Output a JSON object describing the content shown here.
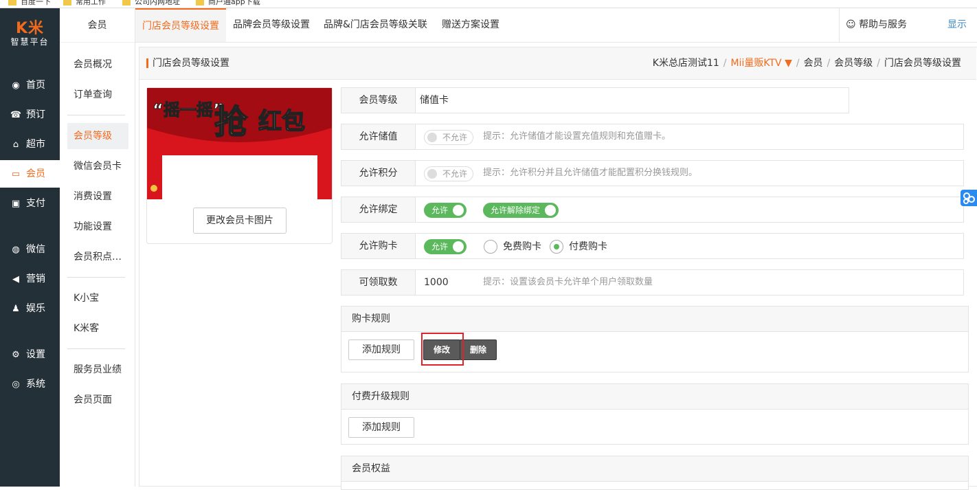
{
  "bookmarks": [
    "百度一下",
    "常用工作",
    "公司内网地址",
    "商户通app下载"
  ],
  "logo": {
    "brand": "K米",
    "subtitle": "智慧平台"
  },
  "leftnav": [
    {
      "label": "首页",
      "icon": "gauge-icon",
      "glyph": "◉"
    },
    {
      "label": "预订",
      "icon": "phone-icon",
      "glyph": "☎"
    },
    {
      "label": "超市",
      "icon": "basket-icon",
      "glyph": "⌂"
    },
    {
      "label": "会员",
      "icon": "card-icon",
      "glyph": "▭",
      "active": true
    },
    {
      "label": "支付",
      "icon": "money-icon",
      "glyph": "▣"
    },
    {
      "label": "微信",
      "icon": "wechat-icon",
      "glyph": "◍"
    },
    {
      "label": "营销",
      "icon": "megaphone-icon",
      "glyph": "◀"
    },
    {
      "label": "娱乐",
      "icon": "game-icon",
      "glyph": "♟"
    },
    {
      "label": "设置",
      "icon": "gears-icon",
      "glyph": "⚙"
    },
    {
      "label": "系统",
      "icon": "chrome-icon",
      "glyph": "◎"
    }
  ],
  "subnav": {
    "header": "会员",
    "items": [
      "会员概况",
      "订单查询",
      "会员等级",
      "微信会员卡",
      "消费设置",
      "功能设置",
      "会员积点…",
      "K小宝",
      "K米客",
      "服务员业绩",
      "会员页面"
    ],
    "active": "会员等级"
  },
  "tabs": [
    "门店会员等级设置",
    "品牌会员等级设置",
    "品牌&门店会员等级关联",
    "赠送方案设置"
  ],
  "help": {
    "icon": "smiley-icon",
    "label": "帮助与服务"
  },
  "show_label": "显示",
  "page": {
    "title": "门店会员等级设置",
    "breadcrumb": {
      "company": "K米总店测试11",
      "store": "Mii量贩KTV",
      "items": [
        "会员",
        "会员等级",
        "门店会员等级设置"
      ]
    }
  },
  "card": {
    "image_quote": "“摇一摇”",
    "image_big": "抢",
    "image_rest": "红包",
    "change_button": "更改会员卡图片"
  },
  "form": {
    "level": {
      "label": "会员等级",
      "value": "储值卡"
    },
    "allow_stored": {
      "label": "允许储值",
      "toggle": "不允许",
      "hint": "提示：允许储值才能设置充值规则和充值赠卡。"
    },
    "allow_points": {
      "label": "允许积分",
      "toggle": "不允许",
      "hint": "提示：允许积分并且允许储值才能配置积分换钱规则。"
    },
    "allow_bind": {
      "label": "允许绑定",
      "toggle1": "允许",
      "toggle2": "允许解除绑定"
    },
    "allow_buy": {
      "label": "允许购卡",
      "toggle": "允许",
      "radio_free": "免费购卡",
      "radio_paid": "付费购卡"
    },
    "max_claim": {
      "label": "可领取数",
      "value": "1000",
      "hint": "提示：设置该会员卡允许单个用户领取数量"
    }
  },
  "panels": {
    "buy_rules": {
      "title": "购卡规则",
      "add": "添加规则",
      "edit": "修改",
      "delete": "删除"
    },
    "upgrade_rules": {
      "title": "付费升级规则",
      "add": "添加规则"
    },
    "benefits": {
      "title": "会员权益"
    }
  },
  "colors": {
    "accent": "#f26b1d",
    "nav_bg": "#243038",
    "toggle_on": "#5cb85c",
    "highlight": "#e0232a"
  }
}
